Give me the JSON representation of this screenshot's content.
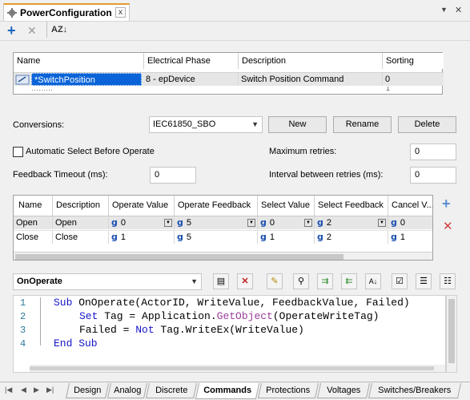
{
  "window": {
    "tab_title": "PowerConfiguration",
    "close_glyph": "x"
  },
  "toolbar": {
    "add": "+",
    "delete": "✕",
    "sort": "AZ↓"
  },
  "main_grid": {
    "columns": [
      "Name",
      "Electrical Phase",
      "Description",
      "Sorting"
    ],
    "rows": [
      {
        "name": "*SwitchPosition",
        "phase": "8 - epDevice",
        "description": "Switch Position Command",
        "sorting": "0"
      }
    ]
  },
  "conversions": {
    "label": "Conversions:",
    "value": "IEC61850_SBO",
    "new": "New",
    "rename": "Rename",
    "delete": "Delete"
  },
  "options": {
    "auto_select_label": "Automatic Select Before Operate",
    "max_retries_label": "Maximum retries:",
    "max_retries_value": "0",
    "feedback_timeout_label": "Feedback Timeout (ms):",
    "feedback_timeout_value": "0",
    "interval_label": "Interval between retries (ms):",
    "interval_value": "0"
  },
  "cmd_grid": {
    "columns": [
      "Name",
      "Description",
      "Operate Value",
      "Operate Feedback",
      "Select Value",
      "Select Feedback",
      "Cancel V..."
    ],
    "rows": [
      {
        "name": "Open",
        "description": "Open",
        "operate_value": "0",
        "operate_feedback": "5",
        "select_value": "0",
        "select_feedback": "2",
        "cancel_value": "0"
      },
      {
        "name": "Close",
        "description": "Close",
        "operate_value": "1",
        "operate_feedback": "5",
        "select_value": "1",
        "select_feedback": "2",
        "cancel_value": "1"
      }
    ]
  },
  "script": {
    "event": "OnOperate",
    "lines": [
      "1",
      "2",
      "3",
      "4"
    ]
  },
  "bottom_tabs": [
    "Design",
    "Analog",
    "Discrete",
    "Commands",
    "Protections",
    "Voltages",
    "Switches/Breakers"
  ],
  "code_tokens": {
    "l1_kw": "Sub",
    "l1_rest": " OnOperate(ActorID, WriteValue, FeedbackValue, Failed)",
    "l2_kw": "Set",
    "l2_a": " Tag = Application.",
    "l2_fn": "GetObject",
    "l2_b": "(OperateWriteTag)",
    "l3_a": "Failed = ",
    "l3_kw": "Not",
    "l3_b": " Tag.WriteEx(WriteValue)",
    "l4_kw": "End Sub"
  },
  "colors": {
    "accent": "#e39a2a",
    "selection": "#0a64d8",
    "keyword": "#1515c8",
    "function": "#9a3d9a"
  }
}
